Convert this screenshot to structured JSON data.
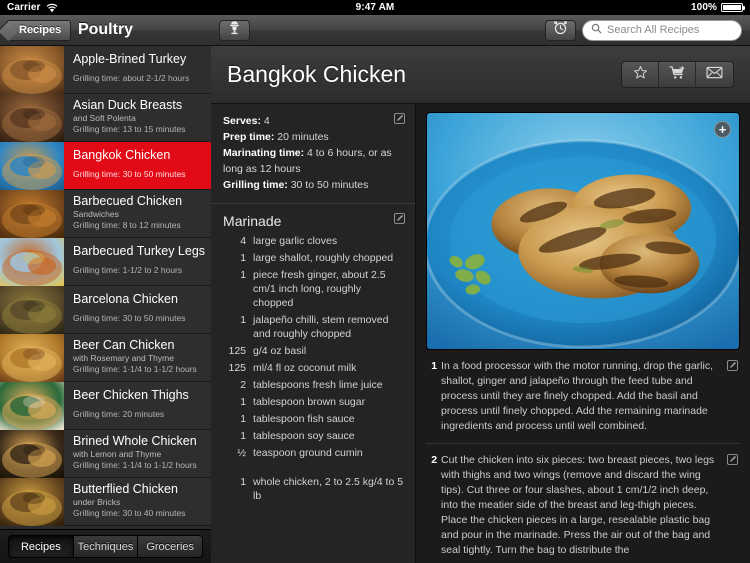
{
  "status_bar": {
    "carrier": "Carrier",
    "wifi_icon": "wifi-icon",
    "time": "9:47 AM",
    "battery_percent": "100%",
    "battery_icon": "battery-full-icon"
  },
  "sidebar": {
    "back_label": "Recipes",
    "title": "Poultry",
    "recipes": [
      {
        "title": "Apple-Brined Turkey",
        "subtitle": "",
        "time": "Grilling time: about 2-1/2 hours",
        "selected": false,
        "thumb": "turkey-roast-thumb",
        "c1": "#8a5a2b",
        "c2": "#c98a44",
        "c3": "#4a2f18"
      },
      {
        "title": "Asian Duck Breasts",
        "subtitle": "and Soft Polenta",
        "time": "Grilling time: 13 to 15 minutes",
        "selected": false,
        "thumb": "duck-breast-thumb",
        "c1": "#5a3a22",
        "c2": "#9b6a3c",
        "c3": "#2d1d10"
      },
      {
        "title": "Bangkok Chicken",
        "subtitle": "",
        "time": "Grilling time: 30 to 50 minutes",
        "selected": true,
        "thumb": "bangkok-chicken-thumb",
        "c1": "#2f86c4",
        "c2": "#c79a52",
        "c3": "#1b5f91"
      },
      {
        "title": "Barbecued Chicken",
        "subtitle": "Sandwiches",
        "time": "Grilling time: 8 to 12 minutes",
        "selected": false,
        "thumb": "bbq-sandwich-thumb",
        "c1": "#7a4a1c",
        "c2": "#c07a2c",
        "c3": "#4a2a0c"
      },
      {
        "title": "Barbecued Turkey Legs",
        "subtitle": "",
        "time": "Grilling time: 1-1/2 to 2 hours",
        "selected": false,
        "thumb": "turkey-legs-thumb",
        "c1": "#9fc6de",
        "c2": "#c76a2a",
        "c3": "#e0c45a"
      },
      {
        "title": "Barcelona Chicken",
        "subtitle": "",
        "time": "Grilling time: 30 to 50 minutes",
        "selected": false,
        "thumb": "barcelona-chicken-thumb",
        "c1": "#5a4a2a",
        "c2": "#8a7a3a",
        "c3": "#2a2414"
      },
      {
        "title": "Beer Can Chicken",
        "subtitle": "with Rosemary and Thyme",
        "time": "Grilling time: 1-1/4 to 1-1/2 hours",
        "selected": false,
        "thumb": "beer-can-chicken-thumb",
        "c1": "#b07a2a",
        "c2": "#e0b05a",
        "c3": "#6a3a1a"
      },
      {
        "title": "Beer Chicken Thighs",
        "subtitle": "",
        "time": "Grilling time: 20 minutes",
        "selected": false,
        "thumb": "chicken-thighs-thumb",
        "c1": "#2a6a3a",
        "c2": "#d8a85a",
        "c3": "#e8e0d0"
      },
      {
        "title": "Brined Whole Chicken",
        "subtitle": "with Lemon and Thyme",
        "time": "Grilling time: 1-1/4 to 1-1/2 hours",
        "selected": false,
        "thumb": "brined-chicken-thumb",
        "c1": "#3a2a1a",
        "c2": "#d0a050",
        "c3": "#1a1208"
      },
      {
        "title": "Butterflied Chicken",
        "subtitle": "under Bricks",
        "time": "Grilling time: 30 to 40 minutes",
        "selected": false,
        "thumb": "butterflied-chicken-thumb",
        "c1": "#6a4a20",
        "c2": "#c89a40",
        "c3": "#30200c"
      }
    ],
    "tabs": [
      {
        "label": "Recipes",
        "active": true
      },
      {
        "label": "Techniques",
        "active": false
      },
      {
        "label": "Groceries",
        "active": false
      }
    ]
  },
  "detail": {
    "toolbar": {
      "grill_icon": "grill-icon",
      "timer_icon": "alarm-clock-icon",
      "search_placeholder": "Search All Recipes",
      "search_value": "",
      "search_icon": "search-icon"
    },
    "title": "Bangkok Chicken",
    "actions": [
      {
        "icon": "star-icon",
        "name": "favorite-button"
      },
      {
        "icon": "shopping-cart-icon",
        "name": "add-to-groceries-button"
      },
      {
        "icon": "envelope-icon",
        "name": "email-recipe-button"
      }
    ],
    "meta": [
      {
        "label": "Serves:",
        "value": " 4"
      },
      {
        "label": "Prep time:",
        "value": " 20 minutes"
      },
      {
        "label": "Marinating time:",
        "value": " 4 to 6 hours, or as long as 12 hours"
      },
      {
        "label": "Grilling time:",
        "value": " 30 to 50 minutes"
      }
    ],
    "ingredients_heading": "Marinade",
    "ingredients": [
      {
        "qty": "4",
        "text": "large garlic cloves"
      },
      {
        "qty": "1",
        "text": "large shallot, roughly chopped"
      },
      {
        "qty": "1",
        "text": "piece fresh ginger, about 2.5 cm/1 inch long, roughly chopped"
      },
      {
        "qty": "1",
        "text": "jalapeño chilli, stem removed and roughly chopped"
      },
      {
        "qty": "125",
        "text": "g/4 oz basil"
      },
      {
        "qty": "125",
        "text": "ml/4 fl oz coconut milk"
      },
      {
        "qty": "2",
        "text": "tablespoons fresh lime juice"
      },
      {
        "qty": "1",
        "text": "tablespoon brown sugar"
      },
      {
        "qty": "1",
        "text": "tablespoon fish sauce"
      },
      {
        "qty": "1",
        "text": "tablespoon soy sauce"
      },
      {
        "qty": "½",
        "text": "teaspoon ground cumin"
      }
    ],
    "ingredients_extra": [
      {
        "qty": "1",
        "text": "whole chicken, 2 to 2.5 kg/4 to 5 lb"
      }
    ],
    "photo": {
      "alt": "grilled-chicken-on-blue-plate",
      "add_photo_label": "+"
    },
    "steps": [
      {
        "num": "1",
        "text": "In a food processor with the motor running, drop the garlic, shallot, ginger and jalapeño through the feed tube and process until they are finely chopped. Add the basil and process until finely chopped. Add the remaining marinade ingredients and process until well combined."
      },
      {
        "num": "2",
        "text": "Cut the chicken into six pieces: two breast pieces, two legs with thighs and two wings (remove and discard the wing tips). Cut three or four slashes, about 1 cm/1/2 inch deep, into the meatier side of the breast and leg-thigh pieces. Place the chicken pieces in a large, resealable plastic bag and pour in the marinade. Press the air out of the bag and seal tightly. Turn the bag to distribute the"
      }
    ],
    "edit_icon": "edit-pencil-icon"
  },
  "colors": {
    "selection_red": "#e20a17",
    "chrome_dark": "#2c2c2c",
    "panel_bg": "#242424"
  }
}
